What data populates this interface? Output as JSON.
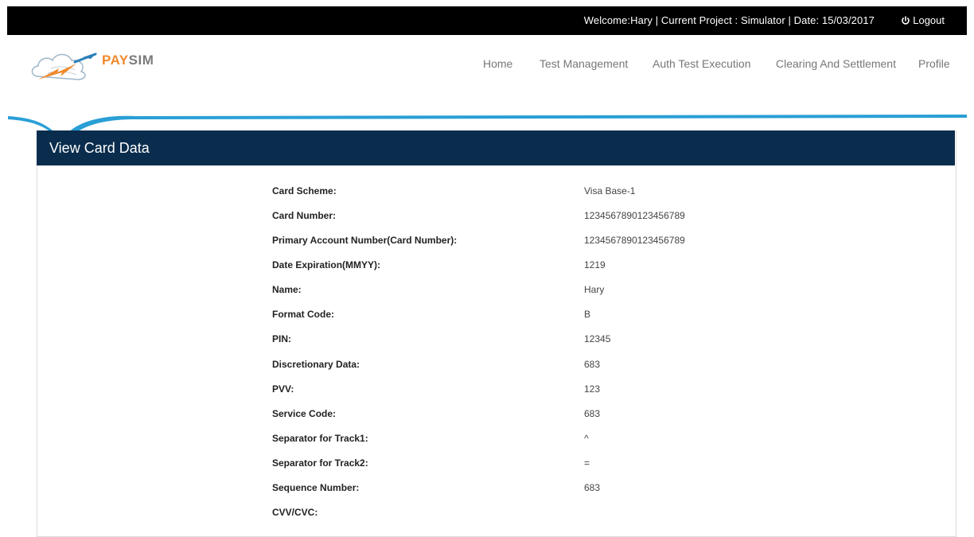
{
  "topbar": {
    "info": "Welcome:Hary  | Current Project : Simulator  |  Date: 15/03/2017",
    "logout": "Logout"
  },
  "logo": {
    "pay": "PAY",
    "sim": "SIM"
  },
  "nav": {
    "home": "Home",
    "test_management": "Test Management",
    "auth_test_execution": "Auth Test Execution",
    "clearing_and_settlement": "Clearing And Settlement",
    "profile": "Profile"
  },
  "panel": {
    "title": "View Card Data"
  },
  "fields": [
    {
      "label": "Card Scheme:",
      "value": "Visa Base-1"
    },
    {
      "label": "Card Number:",
      "value": "1234567890123456789"
    },
    {
      "label": "Primary Account Number(Card Number):",
      "value": "1234567890123456789"
    },
    {
      "label": "Date Expiration(MMYY):",
      "value": "1219"
    },
    {
      "label": "Name:",
      "value": "Hary"
    },
    {
      "label": "Format Code:",
      "value": "B"
    },
    {
      "label": "PIN:",
      "value": "12345"
    },
    {
      "label": "Discretionary Data:",
      "value": "683"
    },
    {
      "label": "PVV:",
      "value": "123"
    },
    {
      "label": "Service Code:",
      "value": "683"
    },
    {
      "label": "Separator for Track1:",
      "value": "^"
    },
    {
      "label": "Separator for Track2:",
      "value": "="
    },
    {
      "label": "Sequence Number:",
      "value": "683"
    },
    {
      "label": "CVV/CVC:",
      "value": ""
    }
  ],
  "colors": {
    "topbar": "#000000",
    "panel_header": "#0a2d4d",
    "accent": "#2a9fd6",
    "logo_orange": "#f08a2c"
  },
  "icons": {
    "logout": "power-icon",
    "logo": "cloud-logo-icon"
  }
}
